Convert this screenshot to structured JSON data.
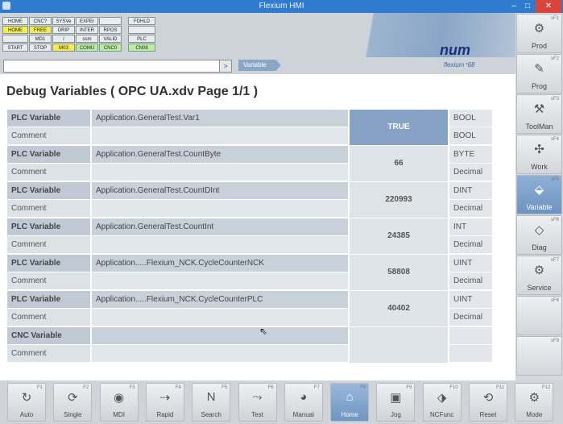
{
  "window": {
    "title": "Flexium HMI",
    "min": "–",
    "max": "□",
    "close": "✕"
  },
  "status_grid": [
    [
      "HOME",
      "CNC?",
      "SYSVe",
      "EXPEr",
      "",
      "",
      "FDHLD"
    ],
    [
      "HOME",
      "FREE",
      "DRIP",
      "INTER",
      "RPOS",
      "",
      ""
    ],
    [
      "",
      "MD1",
      "/",
      "ssm",
      "VALID",
      "",
      "PLC"
    ],
    [
      "START",
      "STOP",
      "M03",
      "COMU",
      "CNC0",
      "",
      "CN08"
    ]
  ],
  "logo": {
    "brand": "num",
    "sub": "flexium⁺68"
  },
  "command": {
    "value": "",
    "arrow": ">"
  },
  "page_tag": "Variable",
  "page_title": "Debug Variables ( OPC UA.xdv Page 1/1 )",
  "rows": [
    {
      "label": "PLC Variable",
      "name": "Application.GeneralTest.Var1",
      "value": "TRUE",
      "type": "BOOL",
      "comment_label": "Comment",
      "comment": "",
      "format": "BOOL",
      "active": true
    },
    {
      "label": "PLC Variable",
      "name": "Application.GeneralTest.CountByte",
      "value": "66",
      "type": "BYTE",
      "comment_label": "Comment",
      "comment": "",
      "format": "Decimal",
      "active": false
    },
    {
      "label": "PLC Variable",
      "name": "Application.GeneralTest.CountDInt",
      "value": "220993",
      "type": "DINT",
      "comment_label": "Comment",
      "comment": "",
      "format": "Decimal",
      "active": false
    },
    {
      "label": "PLC Variable",
      "name": "Application.GeneralTest.CountInt",
      "value": "24385",
      "type": "INT",
      "comment_label": "Comment",
      "comment": "",
      "format": "Decimal",
      "active": false
    },
    {
      "label": "PLC Variable",
      "name": "Application.....Flexium_NCK.CycleCounterNCK",
      "value": "58808",
      "type": "UINT",
      "comment_label": "Comment",
      "comment": "",
      "format": "Decimal",
      "active": false
    },
    {
      "label": "PLC Variable",
      "name": "Application.....Flexium_NCK.CycleCounterPLC",
      "value": "40402",
      "type": "UINT",
      "comment_label": "Comment",
      "comment": "",
      "format": "Decimal",
      "active": false
    },
    {
      "label": "CNC Variable",
      "name": "",
      "value": "",
      "type": "",
      "comment_label": "Comment",
      "comment": "",
      "format": "",
      "active": false
    }
  ],
  "right_buttons": [
    {
      "fkey": "sF1",
      "label": "Prod",
      "icon": "gears-icon",
      "glyph": "⚙",
      "active": false
    },
    {
      "fkey": "sF2",
      "label": "Prog",
      "icon": "program-icon",
      "glyph": "✎",
      "active": false
    },
    {
      "fkey": "sF3",
      "label": "ToolMan",
      "icon": "tool-icon",
      "glyph": "⚒",
      "active": false
    },
    {
      "fkey": "sF4",
      "label": "Work",
      "icon": "work-icon",
      "glyph": "✣",
      "active": false
    },
    {
      "fkey": "sF5",
      "label": "Variable",
      "icon": "variable-icon",
      "glyph": "⬙",
      "active": true
    },
    {
      "fkey": "sF6",
      "label": "Diag",
      "icon": "diag-icon",
      "glyph": "◇",
      "active": false
    },
    {
      "fkey": "sF7",
      "label": "Service",
      "icon": "service-icon",
      "glyph": "⚙",
      "active": false
    },
    {
      "fkey": "sF8",
      "label": "",
      "icon": "",
      "glyph": "",
      "active": false
    },
    {
      "fkey": "sF9",
      "label": "",
      "icon": "",
      "glyph": "",
      "active": false
    }
  ],
  "bottom_buttons": [
    {
      "fkey": "F1",
      "label": "Auto",
      "icon": "auto-icon",
      "glyph": "↻",
      "active": false
    },
    {
      "fkey": "F2",
      "label": "Single",
      "icon": "single-icon",
      "glyph": "⟳",
      "active": false
    },
    {
      "fkey": "F3",
      "label": "MDI",
      "icon": "mdi-icon",
      "glyph": "◉",
      "active": false
    },
    {
      "fkey": "F4",
      "label": "Rapid",
      "icon": "rapid-icon",
      "glyph": "⇢",
      "active": false
    },
    {
      "fkey": "F5",
      "label": "Search",
      "icon": "search-icon",
      "glyph": "N",
      "active": false
    },
    {
      "fkey": "F6",
      "label": "Test",
      "icon": "test-icon",
      "glyph": "⤳",
      "active": false
    },
    {
      "fkey": "F7",
      "label": "Manual",
      "icon": "manual-icon",
      "glyph": "◕",
      "active": false
    },
    {
      "fkey": "F8",
      "label": "Home",
      "icon": "home-icon",
      "glyph": "⌂",
      "active": true
    },
    {
      "fkey": "F9",
      "label": "Jog",
      "icon": "jog-icon",
      "glyph": "▣",
      "active": false
    },
    {
      "fkey": "F10",
      "label": "NCFunc",
      "icon": "ncfunc-icon",
      "glyph": "⬗",
      "active": false
    },
    {
      "fkey": "F11",
      "label": "Reset",
      "icon": "reset-icon",
      "glyph": "⟲",
      "active": false
    },
    {
      "fkey": "F12",
      "label": "Mode",
      "icon": "mode-icon",
      "glyph": "⚙",
      "active": false
    }
  ]
}
